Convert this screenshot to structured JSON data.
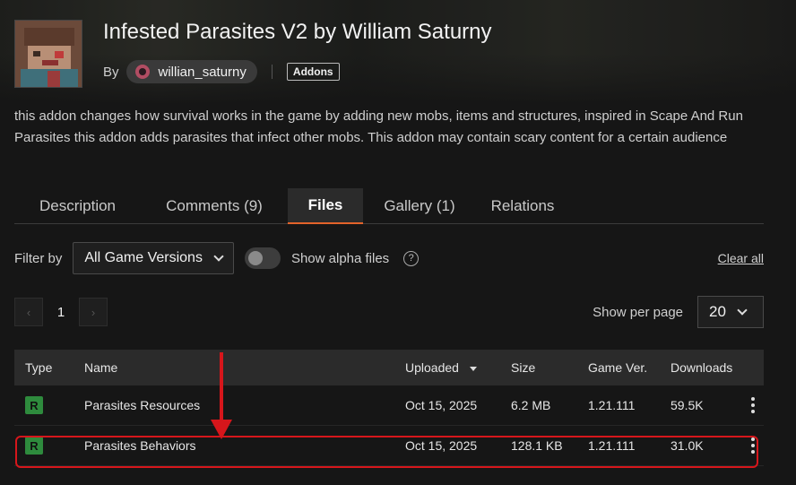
{
  "project": {
    "title": "Infested Parasites V2 by William Saturny",
    "by_label": "By",
    "author": "willian_saturny",
    "category_tag": "Addons",
    "description": "this addon changes how survival works in the game by adding new mobs, items and structures, inspired in Scape And Run Parasites this addon adds parasites that infect other mobs. This addon may contain scary content for a certain audience"
  },
  "tabs": [
    {
      "label": "Description",
      "active": false
    },
    {
      "label": "Comments (9)",
      "active": false
    },
    {
      "label": "Files",
      "active": true
    },
    {
      "label": "Gallery (1)",
      "active": false
    },
    {
      "label": "Relations",
      "active": false
    }
  ],
  "filters": {
    "filter_by_label": "Filter by",
    "game_version_selected": "All Game Versions",
    "show_alpha_label": "Show alpha files",
    "show_alpha_enabled": false,
    "help_symbol": "?",
    "clear_all_label": "Clear all"
  },
  "pagination": {
    "prev_symbol": "‹",
    "next_symbol": "›",
    "current_page": "1",
    "per_page_label": "Show per page",
    "per_page_value": "20"
  },
  "table": {
    "headers": {
      "type": "Type",
      "name": "Name",
      "uploaded": "Uploaded",
      "size": "Size",
      "game_ver": "Game Ver.",
      "downloads": "Downloads"
    },
    "rows": [
      {
        "type": "R",
        "name": "Parasites Resources",
        "uploaded": "Oct 15, 2025",
        "size": "6.2 MB",
        "game_ver": "1.21.111",
        "downloads": "59.5K"
      },
      {
        "type": "R",
        "name": "Parasites Behaviors",
        "uploaded": "Oct 15, 2025",
        "size": "128.1 KB",
        "game_ver": "1.21.111",
        "downloads": "31.0K"
      }
    ]
  },
  "colors": {
    "accent": "#e3632a",
    "release_badge": "#2e8b3d",
    "annotation_red": "#d6161b"
  }
}
